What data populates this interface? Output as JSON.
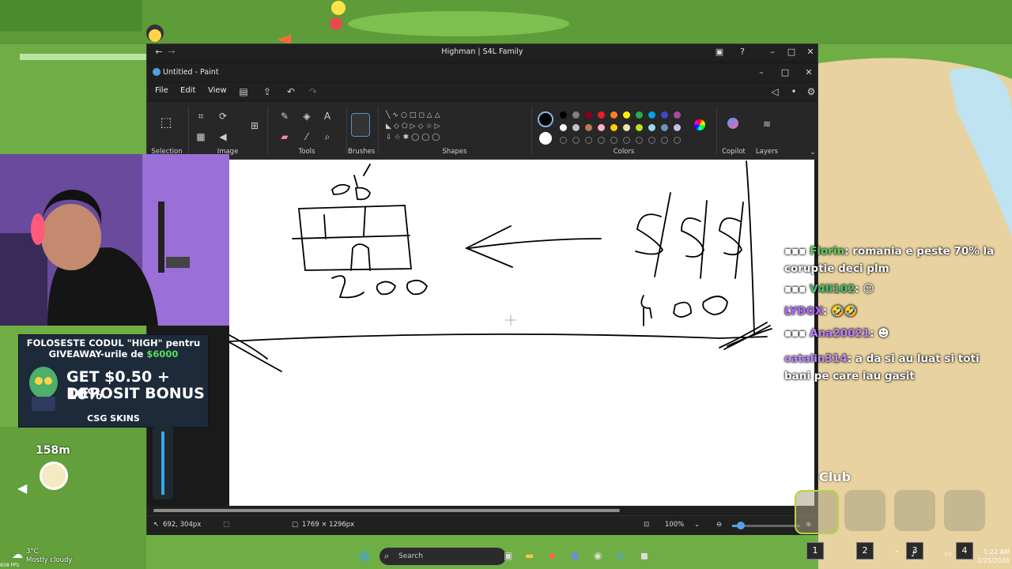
{
  "browser": {
    "title": "Highman | S4L Family"
  },
  "paint": {
    "title": "Untitled - Paint",
    "menu": [
      "File",
      "Edit",
      "View"
    ],
    "groups": [
      "Selection",
      "Image",
      "Tools",
      "Brushes",
      "Shapes",
      "Colors",
      "Copilot",
      "Layers"
    ],
    "palette": [
      "#000000",
      "#7f7f7f",
      "#880015",
      "#ed1c24",
      "#ff7f27",
      "#fff200",
      "#22b14c",
      "#00a2e8",
      "#3f48cc",
      "#a349a4",
      "#ffffff",
      "#c3c3c3",
      "#b97a57",
      "#ffaec9",
      "#ffc90e",
      "#efe4b0",
      "#b5e61d",
      "#99d9ea",
      "#7092be",
      "#c8bfe7"
    ],
    "status": {
      "cursor": "692, 304px",
      "size": "1769 × 1296px",
      "zoom": "100%"
    }
  },
  "ad": {
    "line1": "FOLOSESTE CODUL \"HIGH\" pentru",
    "line2_a": "GIVEAWAY-urile de ",
    "line2_b": "$6000",
    "big1": "GET $0.50 + 10%",
    "big2": "DEPOSIT BONUS",
    "brand": "CSG SKINS",
    "accent": "#55e05a"
  },
  "chat": [
    {
      "user": "Florin",
      "text": " romania e peste 70% la coruptie deci plm",
      "color": "#5fd35f"
    },
    {
      "user": "V4li102",
      "text": "",
      "color": "#46c46e"
    },
    {
      "user": "LYDOX",
      "text": " 🤣🤣",
      "color": "#b36bff"
    },
    {
      "user": "Ana20021",
      "text": "",
      "color": "#c080ff"
    },
    {
      "user": "catalin314",
      "text": " a da si au luat si toti bani pe care iau gasit",
      "color": "#c38cff"
    }
  ],
  "game": {
    "distance": "158m",
    "club": "Club",
    "keys": [
      "1",
      "2",
      "3",
      "4"
    ]
  },
  "taskbar": {
    "search": "Search",
    "temp": "3°C",
    "weather": "Mostly cloudy",
    "time": "1:22 AM",
    "date": "2/25/2026",
    "fps": "658 FPS"
  }
}
